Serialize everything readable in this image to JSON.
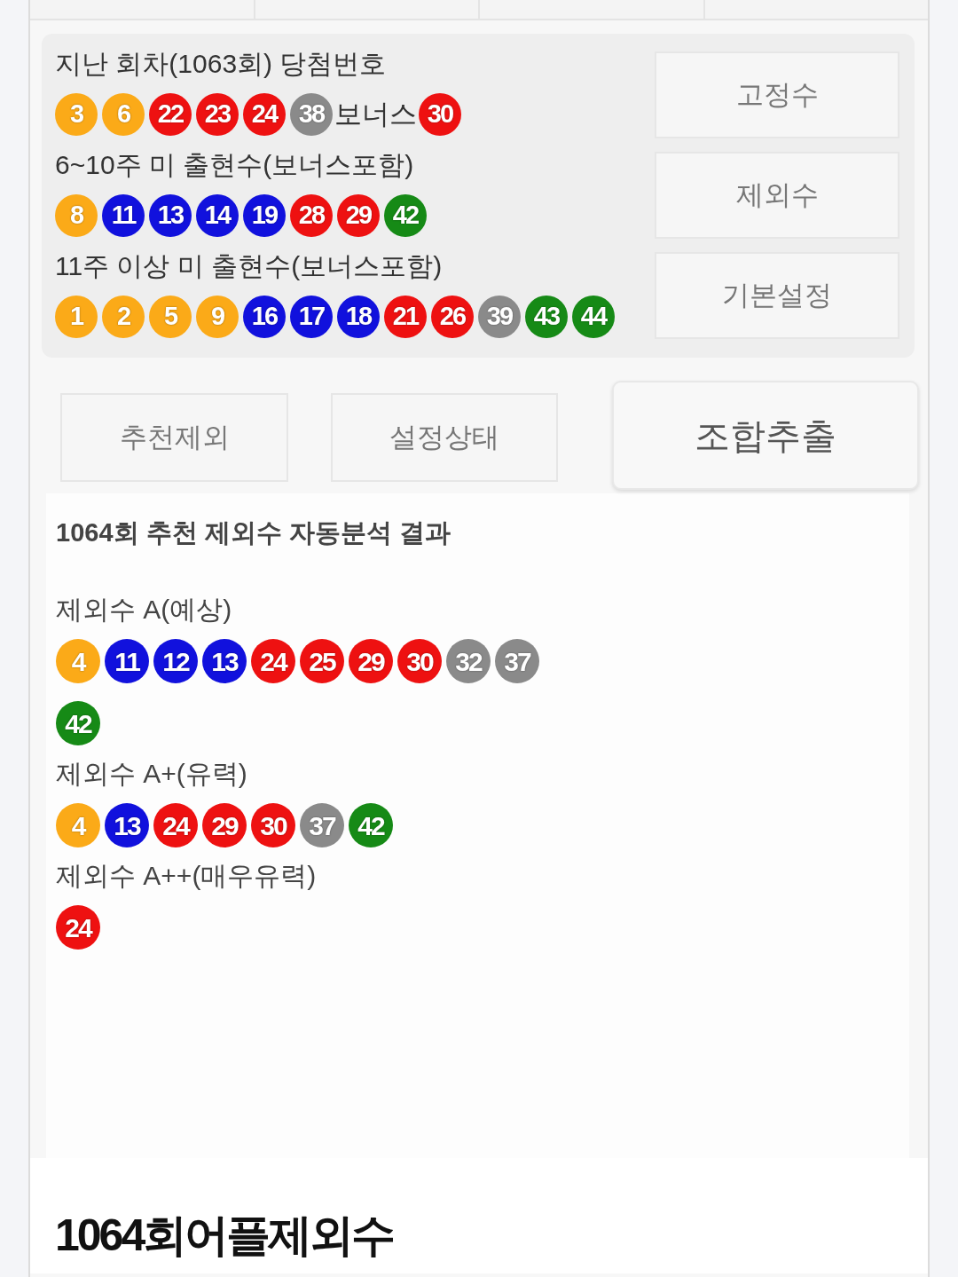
{
  "winning_panel": {
    "sections": [
      {
        "title": "지난 회차(1063회) 당첨번호",
        "balls": [
          {
            "number": "3",
            "color": "#fbaa18"
          },
          {
            "number": "6",
            "color": "#fbaa18"
          },
          {
            "number": "22",
            "color": "#ee1111"
          },
          {
            "number": "23",
            "color": "#ee1111"
          },
          {
            "number": "24",
            "color": "#ee1111"
          },
          {
            "number": "38",
            "color": "#8a8a8a"
          }
        ],
        "bonus_label": "보너스",
        "bonus_ball": {
          "number": "30",
          "color": "#ee1111"
        }
      },
      {
        "title": "6~10주 미 출현수(보너스포함)",
        "balls": [
          {
            "number": "8",
            "color": "#fbaa18"
          },
          {
            "number": "11",
            "color": "#1111dd"
          },
          {
            "number": "13",
            "color": "#1111dd"
          },
          {
            "number": "14",
            "color": "#1111dd"
          },
          {
            "number": "19",
            "color": "#1111dd"
          },
          {
            "number": "28",
            "color": "#ee1111"
          },
          {
            "number": "29",
            "color": "#ee1111"
          },
          {
            "number": "42",
            "color": "#168a16"
          }
        ]
      },
      {
        "title": "11주 이상 미 출현수(보너스포함)",
        "balls": [
          {
            "number": "1",
            "color": "#fbaa18"
          },
          {
            "number": "2",
            "color": "#fbaa18"
          },
          {
            "number": "5",
            "color": "#fbaa18"
          },
          {
            "number": "9",
            "color": "#fbaa18"
          },
          {
            "number": "16",
            "color": "#1111dd"
          },
          {
            "number": "17",
            "color": "#1111dd"
          },
          {
            "number": "18",
            "color": "#1111dd"
          },
          {
            "number": "21",
            "color": "#ee1111"
          },
          {
            "number": "26",
            "color": "#ee1111"
          },
          {
            "number": "39",
            "color": "#8a8a8a"
          },
          {
            "number": "43",
            "color": "#168a16"
          },
          {
            "number": "44",
            "color": "#168a16"
          }
        ]
      }
    ],
    "side_buttons": [
      "고정수",
      "제외수",
      "기본설정"
    ]
  },
  "action_buttons": [
    {
      "label": "추천제외",
      "kind": "normal"
    },
    {
      "label": "설정상태",
      "kind": "normal"
    },
    {
      "label": "조합추출",
      "kind": "primary"
    }
  ],
  "result": {
    "title": "1064회 추천 제외수 자동분석 결과",
    "groups": [
      {
        "label": "제외수 A(예상)",
        "balls": [
          {
            "number": "4",
            "color": "#fbaa18"
          },
          {
            "number": "11",
            "color": "#1111dd"
          },
          {
            "number": "12",
            "color": "#1111dd"
          },
          {
            "number": "13",
            "color": "#1111dd"
          },
          {
            "number": "24",
            "color": "#ee1111"
          },
          {
            "number": "25",
            "color": "#ee1111"
          },
          {
            "number": "29",
            "color": "#ee1111"
          },
          {
            "number": "30",
            "color": "#ee1111"
          },
          {
            "number": "32",
            "color": "#8a8a8a"
          },
          {
            "number": "37",
            "color": "#8a8a8a"
          },
          {
            "number": "42",
            "color": "#168a16"
          }
        ]
      },
      {
        "label": "제외수 A+(유력)",
        "balls": [
          {
            "number": "4",
            "color": "#fbaa18"
          },
          {
            "number": "13",
            "color": "#1111dd"
          },
          {
            "number": "24",
            "color": "#ee1111"
          },
          {
            "number": "29",
            "color": "#ee1111"
          },
          {
            "number": "30",
            "color": "#ee1111"
          },
          {
            "number": "37",
            "color": "#8a8a8a"
          },
          {
            "number": "42",
            "color": "#168a16"
          }
        ]
      },
      {
        "label": "제외수 A++(매우유력)",
        "balls": [
          {
            "number": "24",
            "color": "#ee1111"
          }
        ]
      }
    ]
  },
  "heading": "1064회어플제외수"
}
